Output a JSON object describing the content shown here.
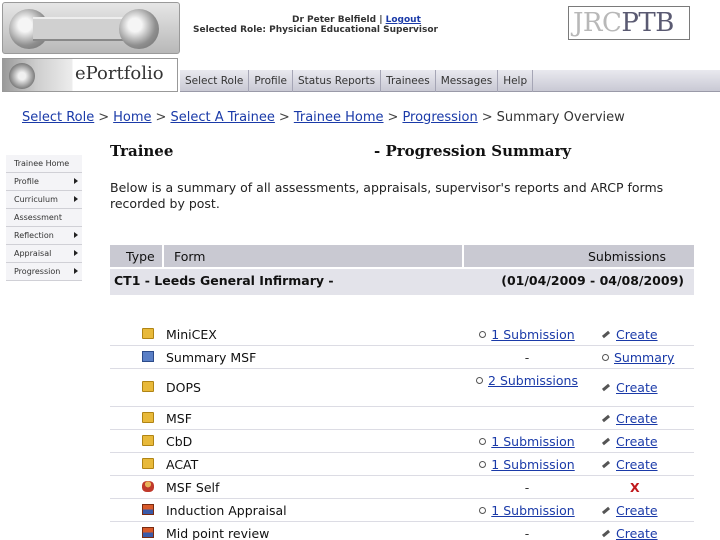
{
  "header": {
    "user_name": "Dr Peter Belfield",
    "separator": " | ",
    "logout": "Logout",
    "role_line": "Selected Role: Physician Educational Supervisor",
    "brand_left": "JRC",
    "brand_right": "PTB"
  },
  "app": {
    "name": "ePortfolio"
  },
  "nav": {
    "items": [
      "Select Role",
      "Profile",
      "Status Reports",
      "Trainees",
      "Messages",
      "Help"
    ]
  },
  "breadcrumb": {
    "items": [
      "Select Role",
      "Home",
      "Select A Trainee",
      "Trainee Home",
      "Progression"
    ],
    "sep": ">",
    "current": "Summary Overview"
  },
  "sidebar": {
    "items": [
      {
        "label": "Trainee Home",
        "has_arrow": false
      },
      {
        "label": "Profile",
        "has_arrow": true
      },
      {
        "label": "Curriculum",
        "has_arrow": true
      },
      {
        "label": "Assessment",
        "has_arrow": false
      },
      {
        "label": "Reflection",
        "has_arrow": true
      },
      {
        "label": "Appraisal",
        "has_arrow": true
      },
      {
        "label": "Progression",
        "has_arrow": true
      }
    ]
  },
  "main": {
    "title_left": "Trainee",
    "title_right": "- Progression Summary",
    "intro": "Below is a summary of all assessments, appraisals, supervisor's reports and ARCP forms recorded by post."
  },
  "table": {
    "headers": {
      "type": "Type",
      "form": "Form",
      "submissions": "Submissions"
    },
    "post": {
      "name": "CT1 - Leeds General Infirmary -",
      "dates": "(01/04/2009 - 04/08/2009)"
    },
    "rows": [
      {
        "icon": "folder-icon",
        "form": "MiniCEX",
        "submissions": "1 Submission",
        "action": "Create"
      },
      {
        "icon": "mail-icon",
        "form": "Summary MSF",
        "submissions": "-",
        "action": "Summary"
      },
      {
        "icon": "folder-icon",
        "form": "DOPS",
        "submissions": "2 Submissions",
        "action": "Create"
      },
      {
        "icon": "folder-icon",
        "form": "MSF",
        "submissions": "",
        "action": "Create"
      },
      {
        "icon": "folder-icon",
        "form": "CbD",
        "submissions": "1 Submission",
        "action": "Create"
      },
      {
        "icon": "folder-icon",
        "form": "ACAT",
        "submissions": "1 Submission",
        "action": "Create"
      },
      {
        "icon": "person-icon",
        "form": "MSF Self",
        "submissions": "-",
        "action": "X"
      },
      {
        "icon": "book-icon",
        "form": "Induction Appraisal",
        "submissions": "1 Submission",
        "action": "Create"
      },
      {
        "icon": "book-icon",
        "form": "Mid point review",
        "submissions": "-",
        "action": "Create"
      }
    ]
  }
}
